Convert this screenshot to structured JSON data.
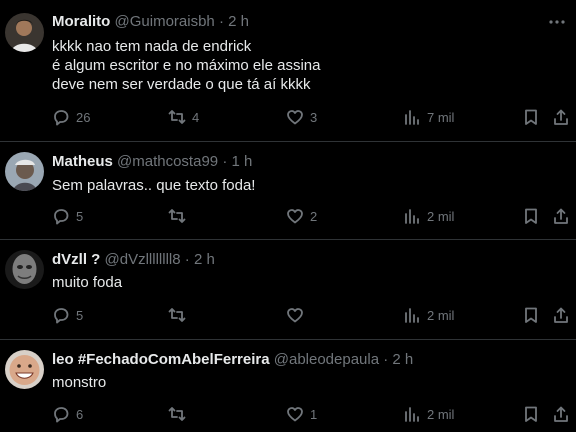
{
  "tweets": [
    {
      "name": "Moralito",
      "handle": "@Guimoraisbh",
      "sep": "·",
      "time": "2 h",
      "text": "kkkk nao tem nada de endrick\né algum escritor e no máximo ele assina\ndeve nem ser verdade o que tá aí kkkk",
      "replies": "26",
      "retweets": "4",
      "likes": "3",
      "views": "7 mil",
      "avatar_color": "#5a4a3e"
    },
    {
      "name": "Matheus",
      "handle": "@mathcosta99",
      "sep": "·",
      "time": "1 h",
      "text": "Sem palavras.. que texto foda!",
      "replies": "5",
      "retweets": "",
      "likes": "2",
      "views": "2 mil",
      "avatar_color": "#8a9aa8"
    },
    {
      "name": "dVzll ?",
      "handle": "@dVzllllllll8",
      "sep": "·",
      "time": "2 h",
      "text": "muito foda",
      "replies": "5",
      "retweets": "",
      "likes": "",
      "views": "2 mil",
      "avatar_color": "#6e6e6e"
    },
    {
      "name": "leo #FechadoComAbelFerreira",
      "handle": "@ableodepaula",
      "sep": "·",
      "time": "2 h",
      "text": "monstro",
      "replies": "6",
      "retweets": "",
      "likes": "1",
      "views": "2 mil",
      "avatar_color": "#c9a48a"
    }
  ],
  "colors": {
    "background": "#000000",
    "text": "#e7e9ea",
    "muted": "#71767b",
    "divider": "#2f3336"
  }
}
